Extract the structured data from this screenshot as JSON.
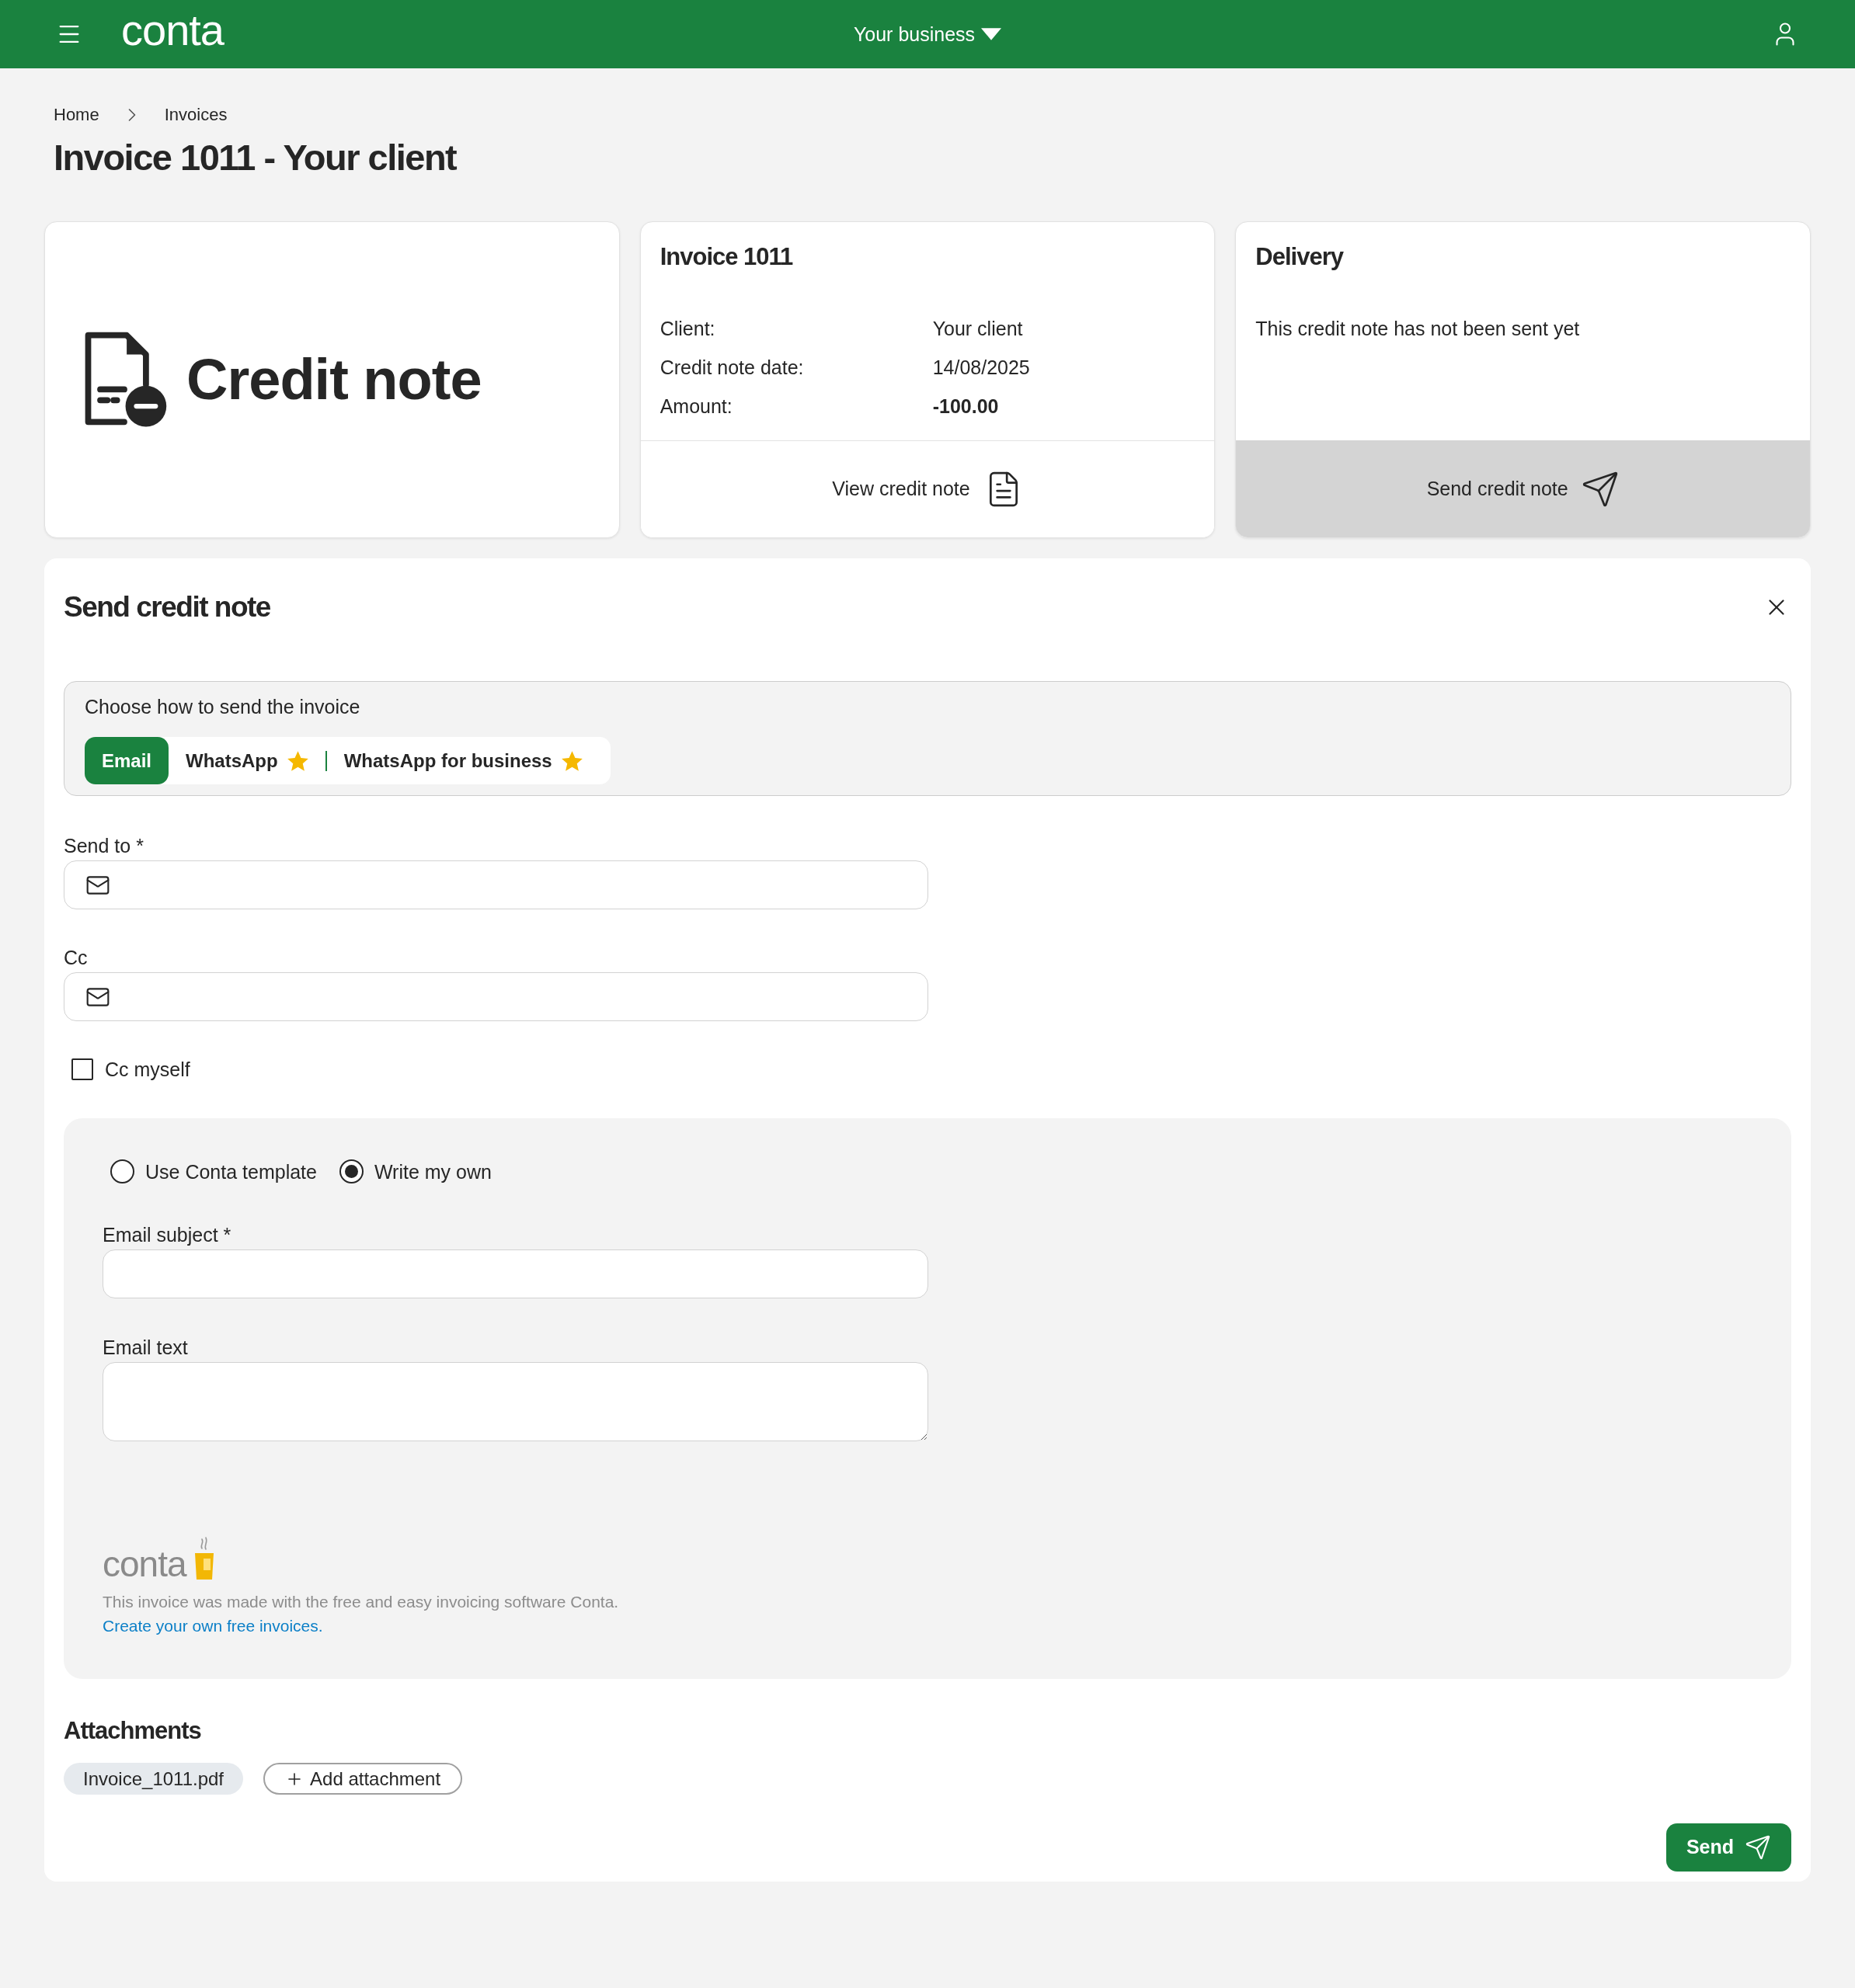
{
  "header": {
    "logo": "conta",
    "business_menu": "Your business"
  },
  "breadcrumb": [
    "Home",
    "Invoices"
  ],
  "title": "Invoice 1011 - Your client",
  "document_card": {
    "label": "Credit note"
  },
  "invoice_card": {
    "title": "Invoice 1011",
    "details": [
      {
        "label": "Client:",
        "value": "Your client",
        "bold": false
      },
      {
        "label": "Credit note date:",
        "value": "14/08/2025",
        "bold": false
      },
      {
        "label": "Amount:",
        "value": "-100.00",
        "bold": true
      }
    ],
    "action": "View credit note"
  },
  "delivery_card": {
    "title": "Delivery",
    "status": "This credit note has not been sent yet",
    "action": "Send credit note"
  },
  "send_panel": {
    "title": "Send credit note",
    "method": {
      "prompt": "Choose how to send the invoice",
      "options": [
        {
          "label": "Email",
          "selected": true,
          "starred": false
        },
        {
          "label": "WhatsApp",
          "selected": false,
          "starred": true
        },
        {
          "label": "WhatsApp for business",
          "selected": false,
          "starred": true
        }
      ]
    },
    "send_to": {
      "label": "Send to *"
    },
    "cc": {
      "label": "Cc"
    },
    "cc_myself": {
      "label": "Cc myself",
      "checked": false
    },
    "message": {
      "modes": [
        {
          "label": "Use Conta template",
          "selected": false
        },
        {
          "label": "Write my own",
          "selected": true
        }
      ],
      "subject": {
        "label": "Email subject *"
      },
      "text": {
        "label": "Email text"
      },
      "footer": {
        "logo": "conta",
        "note": "This invoice was made with the free and easy invoicing software Conta.",
        "link": "Create your own free invoices."
      }
    },
    "attachments": {
      "title": "Attachments",
      "files": [
        "Invoice_1011.pdf"
      ],
      "add_button": "Add attachment"
    },
    "send_button": "Send"
  }
}
